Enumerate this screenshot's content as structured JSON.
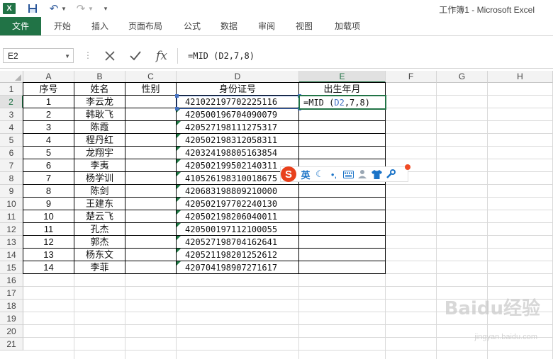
{
  "window": {
    "title": "工作簿1 - Microsoft Excel"
  },
  "ribbon": {
    "tabs": [
      "文件",
      "开始",
      "插入",
      "页面布局",
      "公式",
      "数据",
      "审阅",
      "视图",
      "加载项"
    ]
  },
  "formula_bar": {
    "name_box": "E2",
    "formula": "=MID (D2,7,8)"
  },
  "sheet": {
    "columns": [
      "A",
      "B",
      "C",
      "D",
      "E",
      "F",
      "G",
      "H"
    ],
    "rows": [
      "1",
      "2",
      "3",
      "4",
      "5",
      "6",
      "7",
      "8",
      "9",
      "10",
      "11",
      "12",
      "13",
      "14",
      "15",
      "16",
      "17",
      "18",
      "19",
      "20",
      "21"
    ],
    "headers": [
      "序号",
      "姓名",
      "性别",
      "身份证号",
      "出生年月"
    ],
    "data": [
      {
        "no": "1",
        "name": "李云龙",
        "id": "421022197702225116"
      },
      {
        "no": "2",
        "name": "韩耿飞",
        "id": "420500196704090079"
      },
      {
        "no": "3",
        "name": "陈霞",
        "id": "420527198111275317"
      },
      {
        "no": "4",
        "name": "程丹红",
        "id": "420502198312058311"
      },
      {
        "no": "5",
        "name": "龙翔宇",
        "id": "420324198805163854"
      },
      {
        "no": "6",
        "name": "李夷",
        "id": "420502199502140311"
      },
      {
        "no": "7",
        "name": "杨学训",
        "id": "410526198310018675"
      },
      {
        "no": "8",
        "name": "陈剑",
        "id": "420683198809210000"
      },
      {
        "no": "9",
        "name": "王建东",
        "id": "420502197702240130"
      },
      {
        "no": "10",
        "name": "楚云飞",
        "id": "420502198206040011"
      },
      {
        "no": "11",
        "name": "孔杰",
        "id": "420500197112100055"
      },
      {
        "no": "12",
        "name": "郭杰",
        "id": "420527198704162641"
      },
      {
        "no": "13",
        "name": "杨东文",
        "id": "420521198201252612"
      },
      {
        "no": "14",
        "name": "李菲",
        "id": "420704198907271617"
      }
    ],
    "edit_cell": {
      "prefix": "=MID (",
      "ref": "D2",
      "suffix": ",7,8)"
    }
  },
  "ime_toolbar": {
    "mode_label": "英",
    "logo": "S"
  },
  "watermark": {
    "text": "Baidu经验",
    "sub": "jingyan.baidu.com"
  }
}
